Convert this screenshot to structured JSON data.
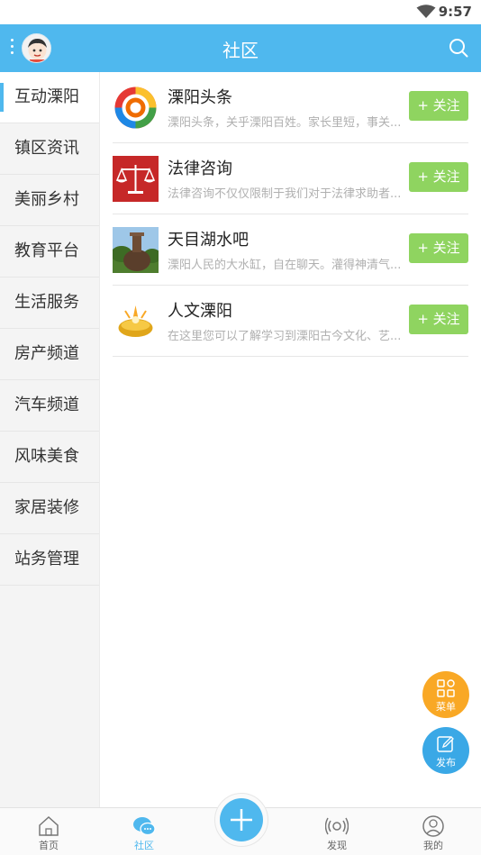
{
  "status_bar": {
    "time": "9:57",
    "wifi_icon": "wifi-icon"
  },
  "header": {
    "title": "社区",
    "menu_icon": "more-vertical-icon",
    "search_icon": "search-icon"
  },
  "sidebar": {
    "items": [
      {
        "label": "互动溧阳",
        "active": true
      },
      {
        "label": "镇区资讯"
      },
      {
        "label": "美丽乡村"
      },
      {
        "label": "教育平台"
      },
      {
        "label": "生活服务"
      },
      {
        "label": "房产频道"
      },
      {
        "label": "汽车频道"
      },
      {
        "label": "风味美食"
      },
      {
        "label": "家居装修"
      },
      {
        "label": "站务管理"
      }
    ]
  },
  "list": {
    "items": [
      {
        "name": "溧阳头条",
        "desc": "溧阳头条，关乎溧阳百姓。家长里短，事关...",
        "follow": "+ 关注"
      },
      {
        "name": "法律咨询",
        "desc": "法律咨询不仅仅限制于我们对于法律求助者...",
        "follow": "+ 关注"
      },
      {
        "name": "天目湖水吧",
        "desc": "溧阳人民的大水缸，自在聊天。灌得神清气...",
        "follow": "+ 关注"
      },
      {
        "name": "人文溧阳",
        "desc": "在这里您可以了解学习到溧阳古今文化、艺...",
        "follow": "+ 关注"
      }
    ]
  },
  "floating": {
    "menu_label": "菜单",
    "post_label": "发布"
  },
  "bottom_nav": {
    "items": [
      {
        "label": "首页"
      },
      {
        "label": "社区",
        "active": true
      },
      {
        "label": "发现"
      },
      {
        "label": "我的"
      }
    ]
  },
  "colors": {
    "primary": "#4fb8ee",
    "follow": "#8fd460",
    "menu_fab": "#f9a825",
    "post_fab": "#3aa8e6"
  }
}
